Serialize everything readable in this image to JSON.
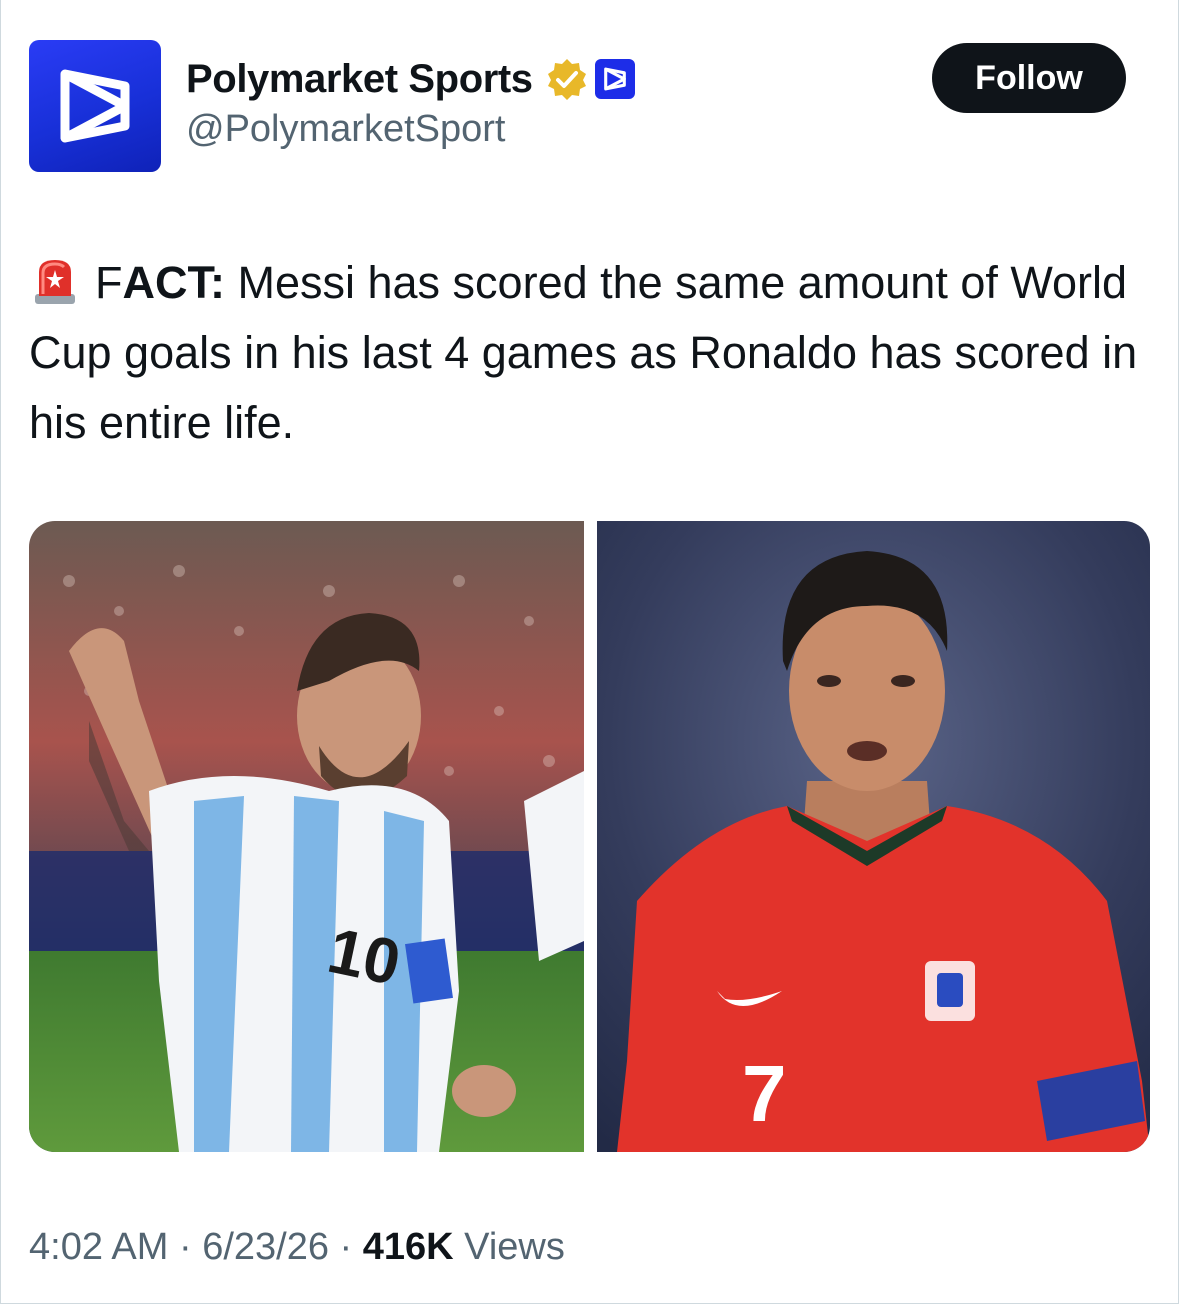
{
  "header": {
    "display_name": "Polymarket Sports",
    "handle": "@PolymarketSport",
    "follow_label": "Follow"
  },
  "tweet": {
    "lead_letter": "F",
    "bold_label": "ACT:",
    "body": " Messi has scored the same amount of World Cup goals in his last 4 games as Ronaldo has scored in his entire life."
  },
  "media": {
    "left": {
      "jersey_number": "10"
    },
    "right": {
      "jersey_number": "7"
    }
  },
  "meta": {
    "time": "4:02 AM",
    "sep1": " · ",
    "date": "6/23/26",
    "sep2": " · ",
    "views_count": "416K",
    "views_label": " Views"
  },
  "colors": {
    "brand_blue": "#1d2de8",
    "verified_gold": "#e8b829",
    "follow_bg": "#0f1419",
    "secondary_text": "#536471"
  },
  "icons": [
    "polymarket-logo-icon",
    "verified-badge-icon",
    "affiliate-badge-icon",
    "rotating-light-icon"
  ]
}
